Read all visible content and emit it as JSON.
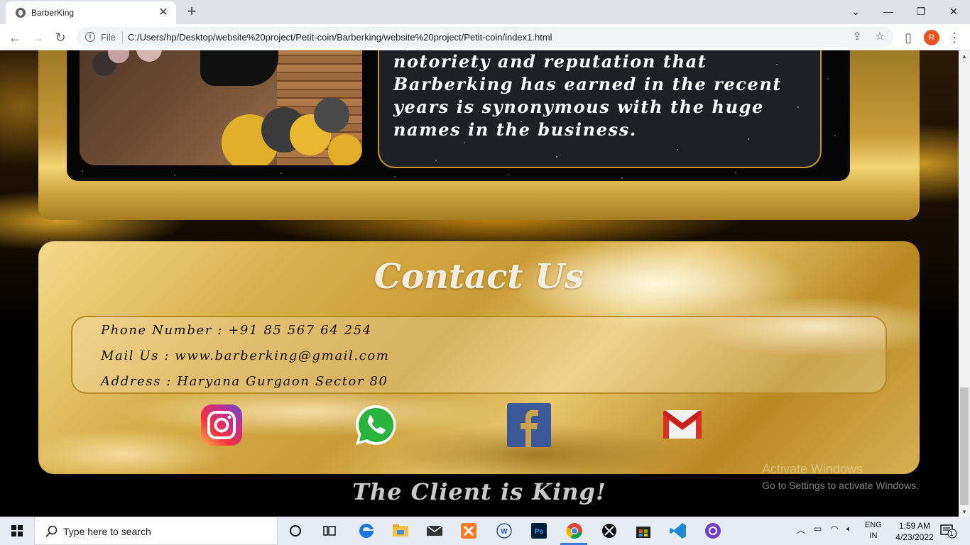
{
  "browser": {
    "tab_title": "BarberKing",
    "file_label": "File",
    "url": "C:/Users/hp/Desktop/website%20project/Petit-coin/Barberking/website%20project/Petit-coin/index1.html",
    "profile_initial": "R"
  },
  "about": {
    "text": "notoriety and reputation that Barberking has earned in the recent years is synonymous with the huge names in the business."
  },
  "contact": {
    "title": "Contact Us",
    "phone": "Phone Number : +91 85 567 64 254",
    "mail": "Mail Us : www.barberking@gmail.com",
    "address": "Address : Haryana Gurgaon Sector 80",
    "social": [
      "instagram-icon",
      "whatsapp-icon",
      "facebook-icon",
      "gmail-icon"
    ]
  },
  "footer": {
    "slogan": "The Client is King!"
  },
  "watermark": {
    "title": "Activate Windows",
    "subtitle": "Go to Settings to activate Windows."
  },
  "taskbar": {
    "search_placeholder": "Type here to search",
    "lang_line1": "ENG",
    "lang_line2": "IN",
    "time": "1:59 AM",
    "date": "4/23/2022",
    "notification_count": "1"
  }
}
